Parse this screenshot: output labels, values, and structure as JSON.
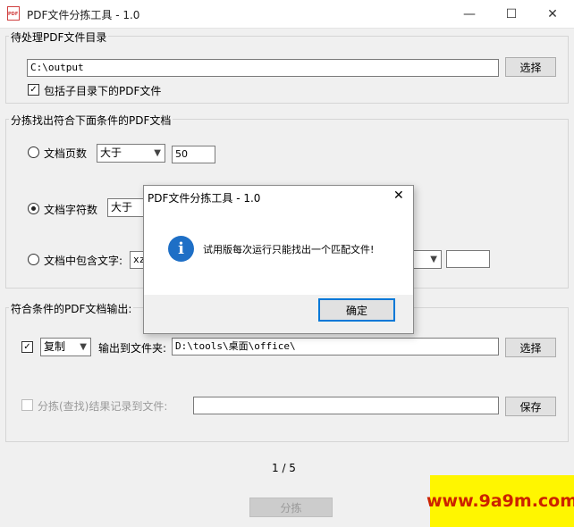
{
  "window": {
    "title": "PDF文件分拣工具 - 1.0",
    "icon_text": "PDF",
    "minimize_glyph": "—",
    "maximize_glyph": "☐",
    "close_glyph": "✕"
  },
  "source_group": {
    "title": "待处理PDF文件目录",
    "path_value": "C:\\output",
    "browse_label": "选择",
    "include_subdirs_label": "包括子目录下的PDF文件",
    "include_subdirs_checked": true
  },
  "criteria_group": {
    "title": "分拣找出符合下面条件的PDF文档",
    "page_count": {
      "label": "文档页数",
      "operator": "大于",
      "value": "50",
      "selected": false
    },
    "char_count": {
      "label": "文档字符数",
      "operator": "大于",
      "selected": true
    },
    "contains_text": {
      "label": "文档中包含文字:",
      "value": "xz",
      "selected": false
    }
  },
  "output_group": {
    "title": "符合条件的PDF文档输出:",
    "enabled_checked": true,
    "mode": "复制",
    "target_label": "输出到文件夹:",
    "target_value": "D:\\tools\\桌面\\office\\",
    "browse_label": "选择",
    "log_label": "分拣(查找)结果记录到文件:",
    "log_value": "",
    "save_label": "保存"
  },
  "status": {
    "page_indicator": "1 / 5",
    "run_label": "分拣"
  },
  "dialog": {
    "title": "PDF文件分拣工具 - 1.0",
    "message": "试用版每次运行只能找出一个匹配文件!",
    "ok_label": "确定",
    "icon_glyph": "i"
  },
  "watermark": {
    "text": "www.9a9m.com"
  },
  "colors": {
    "accent": "#0078d7",
    "info": "#1e6fc6",
    "watermark_bg": "#fff600",
    "watermark_fg": "#cc2200"
  }
}
